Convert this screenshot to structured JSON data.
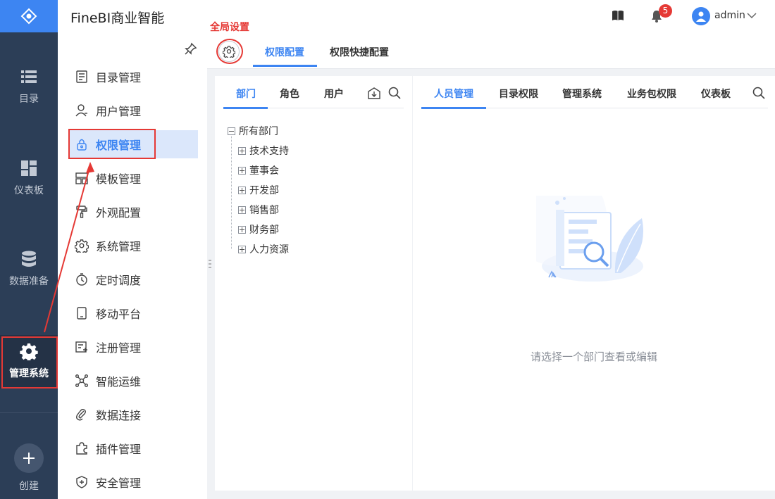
{
  "app": {
    "title": "FineBI商业智能",
    "notifications_count": "5",
    "username": "admin"
  },
  "rail": {
    "items": [
      {
        "label": "目录",
        "icon": "list-icon"
      },
      {
        "label": "仪表板",
        "icon": "dashboard-icon"
      },
      {
        "label": "数据准备",
        "icon": "database-icon"
      },
      {
        "label": "管理系统",
        "icon": "gear-icon"
      },
      {
        "label": "创建",
        "icon": "plus-icon"
      }
    ]
  },
  "menu": {
    "items": [
      {
        "label": "目录管理",
        "icon": "catalog-icon"
      },
      {
        "label": "用户管理",
        "icon": "user-icon"
      },
      {
        "label": "权限管理",
        "icon": "lock-icon"
      },
      {
        "label": "模板管理",
        "icon": "template-icon"
      },
      {
        "label": "外观配置",
        "icon": "brush-icon"
      },
      {
        "label": "系统管理",
        "icon": "settings-icon"
      },
      {
        "label": "定时调度",
        "icon": "timer-icon"
      },
      {
        "label": "移动平台",
        "icon": "mobile-icon"
      },
      {
        "label": "注册管理",
        "icon": "register-icon"
      },
      {
        "label": "智能运维",
        "icon": "network-icon"
      },
      {
        "label": "数据连接",
        "icon": "link-icon"
      },
      {
        "label": "插件管理",
        "icon": "plugin-icon"
      },
      {
        "label": "安全管理",
        "icon": "shield-icon"
      }
    ]
  },
  "tabs": {
    "global_settings_annotation": "全局设置",
    "items": [
      {
        "label": "权限配置"
      },
      {
        "label": "权限快捷配置"
      }
    ]
  },
  "left_panel": {
    "tabs": [
      {
        "label": "部门"
      },
      {
        "label": "角色"
      },
      {
        "label": "用户"
      }
    ],
    "tree": {
      "root": "所有部门",
      "children": [
        "技术支持",
        "董事会",
        "开发部",
        "销售部",
        "财务部",
        "人力资源"
      ]
    }
  },
  "right_panel": {
    "tabs": [
      {
        "label": "人员管理"
      },
      {
        "label": "目录权限"
      },
      {
        "label": "管理系统"
      },
      {
        "label": "业务包权限"
      },
      {
        "label": "仪表板"
      }
    ],
    "empty_message": "请选择一个部门查看或编辑"
  },
  "colors": {
    "accent": "#3d85f2",
    "rail_bg": "#2c3e57",
    "annotation": "#e53935"
  }
}
